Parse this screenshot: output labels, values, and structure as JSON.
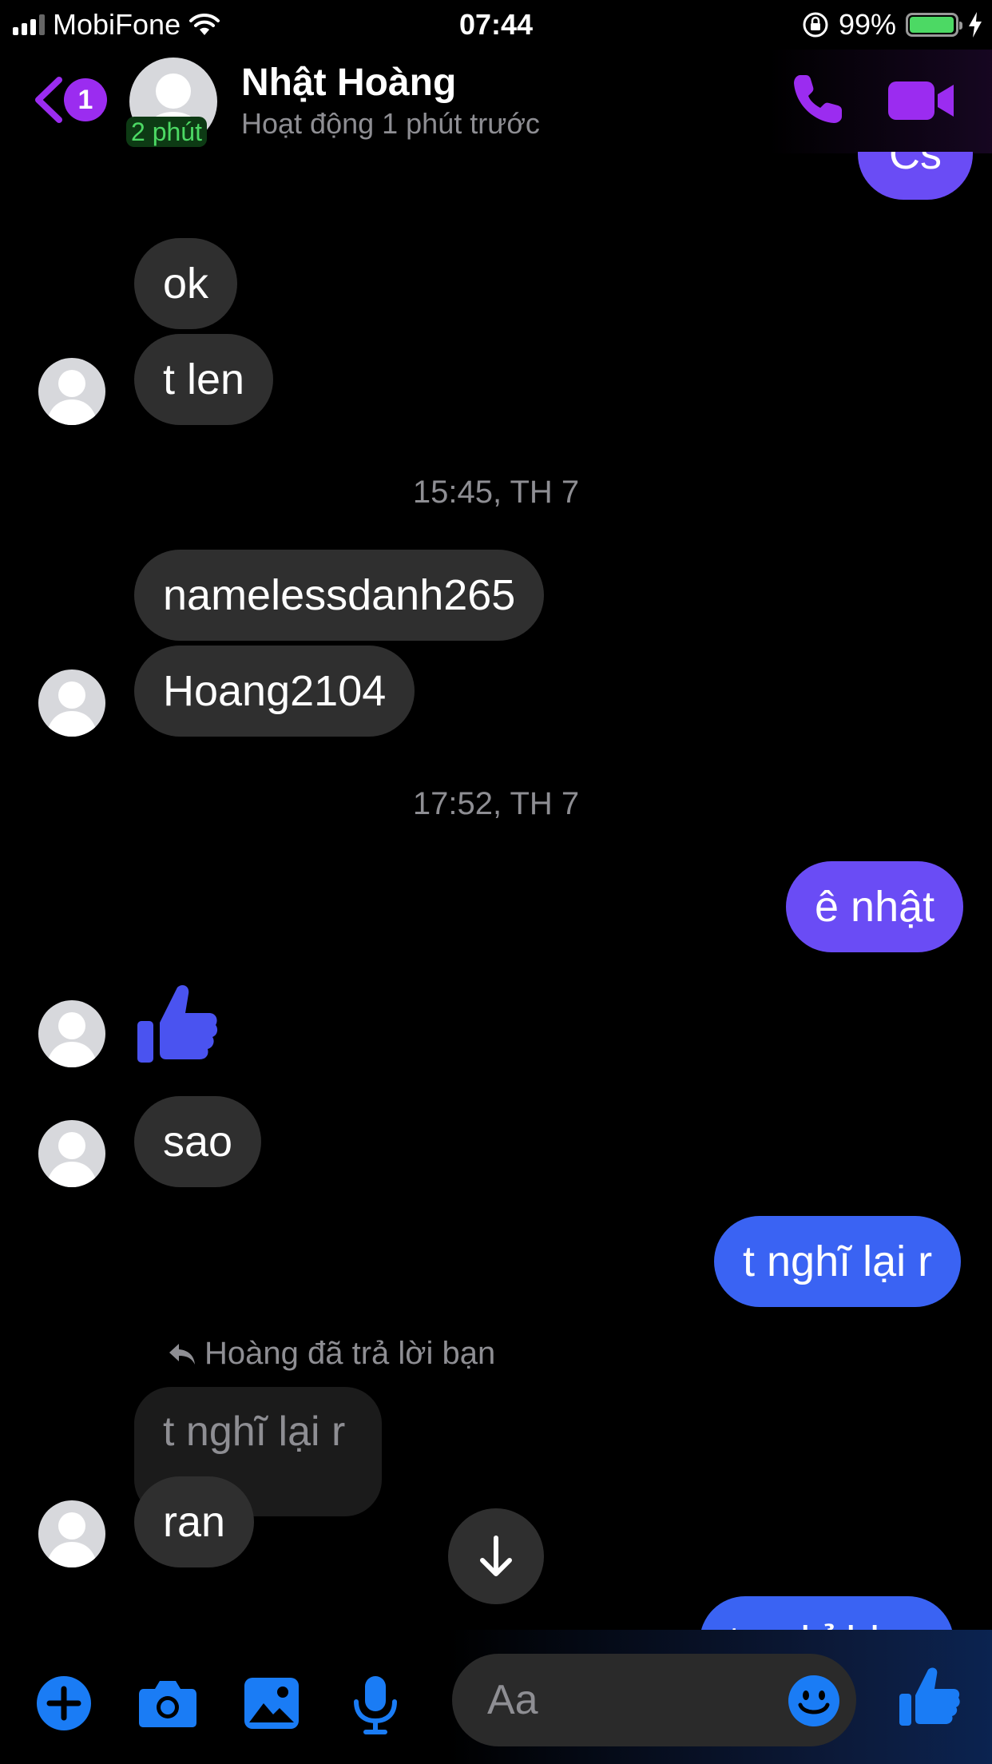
{
  "status_bar": {
    "carrier": "MobiFone",
    "time": "07:44",
    "battery_percent": "99%",
    "battery_level": 0.99,
    "battery_color": "#4cd964"
  },
  "header": {
    "back_badge": "1",
    "contact_name": "Nhật Hoàng",
    "active_badge": "2 phút",
    "status": "Hoạt động 1 phút trước",
    "accent_color": "#9b2cf0",
    "icons": [
      "chevron-left-icon",
      "phone-icon",
      "video-camera-icon"
    ]
  },
  "conversation": {
    "partial_top_message": "Cs",
    "group1": [
      "ok",
      "t len"
    ],
    "timestamp1": "15:45, TH 7",
    "group2": [
      "namelessdanh265",
      "Hoang2104"
    ],
    "timestamp2": "17:52, TH 7",
    "outgoing1": "ê nhật",
    "incoming_like_icon": "thumbs-up-icon",
    "incoming_sao": "sao",
    "outgoing2": "t nghĩ lại r",
    "reply_note": "Hoàng đã trả lời bạn",
    "reply_quote": "t nghĩ lại r",
    "reply_message": "ran",
    "partial_bottom_message": "t nghỉ hlov"
  },
  "composer": {
    "placeholder": "Aa",
    "icons": [
      "plus-icon",
      "camera-icon",
      "image-icon",
      "microphone-icon",
      "emoji-icon",
      "thumbs-up-icon"
    ]
  },
  "colors": {
    "incoming_bubble": "#2f2f2f",
    "outgoing_purple": "#6a4cf5",
    "outgoing_blue": "#3a63f3",
    "icon_blue": "#1a7cf5"
  }
}
